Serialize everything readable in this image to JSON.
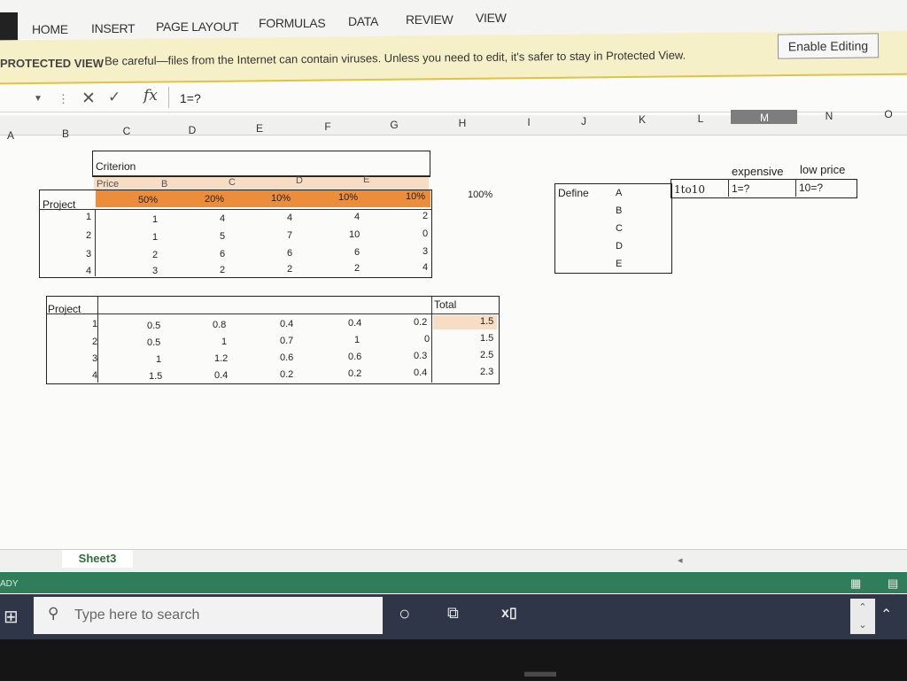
{
  "ribbon": {
    "tabs": [
      "HOME",
      "INSERT",
      "PAGE LAYOUT",
      "FORMULAS",
      "DATA",
      "REVIEW",
      "VIEW"
    ]
  },
  "protected_view": {
    "label": "PROTECTED VIEW",
    "message": "Be careful—files from the Internet can contain viruses. Unless you need to edit, it's safer to stay in Protected View.",
    "button": "Enable Editing"
  },
  "formula_bar": {
    "value": "1=?"
  },
  "columns": [
    "A",
    "B",
    "C",
    "D",
    "E",
    "F",
    "G",
    "H",
    "I",
    "J",
    "K",
    "L",
    "M",
    "N",
    "O"
  ],
  "table1": {
    "title": "Criterion",
    "criteria": [
      "Price",
      "B",
      "C",
      "D",
      "E"
    ],
    "row_header": "Project",
    "weights": [
      "50%",
      "20%",
      "10%",
      "10%",
      "10%"
    ],
    "weight_total": "100%",
    "rows": [
      {
        "id": "1",
        "values": [
          "1",
          "4",
          "4",
          "4",
          "2"
        ]
      },
      {
        "id": "2",
        "values": [
          "1",
          "5",
          "7",
          "10",
          "0"
        ]
      },
      {
        "id": "3",
        "values": [
          "2",
          "6",
          "6",
          "6",
          "3"
        ]
      },
      {
        "id": "4",
        "values": [
          "3",
          "2",
          "2",
          "2",
          "4"
        ]
      }
    ]
  },
  "table2": {
    "row_header": "Project",
    "total_header": "Total",
    "rows": [
      {
        "id": "1",
        "values": [
          "0.5",
          "0.8",
          "0.4",
          "0.4",
          "0.2"
        ],
        "total": "1.5"
      },
      {
        "id": "2",
        "values": [
          "0.5",
          "1",
          "0.7",
          "1",
          "0"
        ],
        "total": "1.5"
      },
      {
        "id": "3",
        "values": [
          "1",
          "1.2",
          "0.6",
          "0.6",
          "0.3"
        ],
        "total": "2.5"
      },
      {
        "id": "4",
        "values": [
          "1.5",
          "0.4",
          "0.2",
          "0.2",
          "0.4"
        ],
        "total": "2.3"
      }
    ]
  },
  "define": {
    "label": "Define",
    "items": [
      "A",
      "B",
      "C",
      "D",
      "E"
    ],
    "scale": "1to10",
    "expensive_label": "expensive",
    "low_price_label": "low price",
    "expensive_value": "1=?",
    "low_price_value": "10=?"
  },
  "sheet_tab": "Sheet3",
  "status": "ADY",
  "taskbar": {
    "search_placeholder": "Type here to search"
  },
  "colors": {
    "header_orange": "#ec8d3c",
    "status_green": "#2f7d5a",
    "taskbar": "#2e3648"
  }
}
